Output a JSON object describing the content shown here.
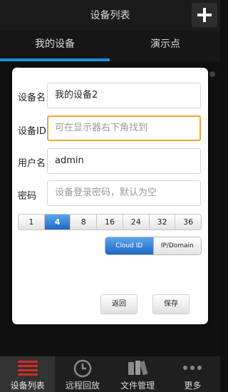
{
  "titlebar": {
    "title": "设备列表"
  },
  "tabs": [
    {
      "label": "我的设备"
    },
    {
      "label": "演示点"
    }
  ],
  "dialog": {
    "name_label": "设备名",
    "name_value": "我的设备2",
    "id_label": "设备ID",
    "id_placeholder": "可在显示器右下角找到",
    "user_label": "用户名",
    "user_value": "admin",
    "password_label": "密码",
    "password_placeholder": "设备登录密码，默认为空",
    "channels": [
      "1",
      "4",
      "8",
      "16",
      "24",
      "32",
      "36"
    ],
    "selected_channel": "4",
    "mode_options": [
      "Cloud ID",
      "IP/Domain"
    ],
    "selected_mode": "Cloud ID",
    "back_label": "返回",
    "save_label": "保存"
  },
  "bottomnav": [
    {
      "label": "设备列表",
      "icon": "list-icon"
    },
    {
      "label": "远程回放",
      "icon": "clock-icon"
    },
    {
      "label": "文件管理",
      "icon": "files-icon"
    },
    {
      "label": "更多",
      "icon": "more-icon"
    }
  ],
  "colors": {
    "accent": "#1a8fd6",
    "focus": "#f0a43a",
    "selected": "#1f68c6",
    "nav_active_icon": "#d22b2b"
  }
}
